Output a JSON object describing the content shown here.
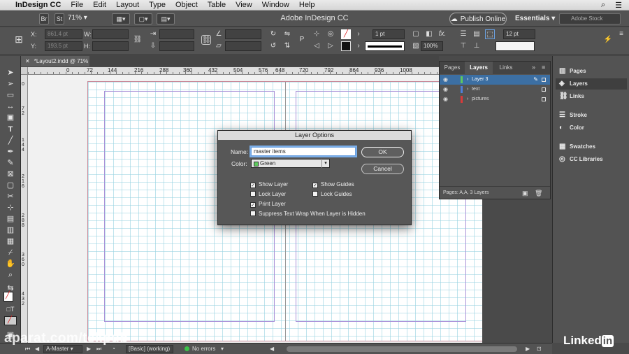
{
  "menubar": {
    "app": "InDesign CC",
    "items": [
      "File",
      "Edit",
      "Layout",
      "Type",
      "Object",
      "Table",
      "View",
      "Window",
      "Help"
    ]
  },
  "appbar": {
    "title": "Adobe InDesign CC",
    "chip_br": "Br",
    "chip_st": "St",
    "zoom": "71%",
    "publish_label": "Publish Online",
    "workspace": "Essentials",
    "stock_placeholder": "Adobe Stock"
  },
  "control": {
    "x_label": "X:",
    "x_value": "861.4 pt",
    "y_label": "Y:",
    "y_value": "193.5 pt",
    "w_label": "W:",
    "h_label": "H:",
    "stroke_weight": "1 pt",
    "opacity": "100%",
    "gutter": "12 pt"
  },
  "document": {
    "tab_title": "*Layout2.indd @ 71%",
    "ruler_h": [
      "0",
      "72",
      "144",
      "216",
      "288",
      "360",
      "432",
      "504",
      "576",
      "648",
      "720",
      "792",
      "864",
      "936",
      "1008"
    ],
    "ruler_v": [
      "0",
      "7 2",
      "1 4 4",
      "2 1 6",
      "2 8 8",
      "3 6 0",
      "4 3 2"
    ]
  },
  "layers_panel": {
    "tabs": [
      "Pages",
      "Layers",
      "Links"
    ],
    "active_tab": "Layers",
    "layers": [
      {
        "name": "Layer 3",
        "color": "#5ec95e",
        "selected": true
      },
      {
        "name": "text",
        "color": "#4f7fd9",
        "selected": false
      },
      {
        "name": "pictures",
        "color": "#d93a3a",
        "selected": false
      }
    ],
    "footer": "Pages: A,A, 3 Layers"
  },
  "dock": {
    "items": [
      "Pages",
      "Layers",
      "Links",
      "Stroke",
      "Color",
      "Swatches",
      "CC Libraries"
    ],
    "active": "Layers"
  },
  "dialog": {
    "title": "Layer Options",
    "name_label": "Name:",
    "name_value": "master items",
    "color_label": "Color:",
    "color_value": "Green",
    "ok_label": "OK",
    "cancel_label": "Cancel",
    "options": [
      {
        "label": "Show Layer",
        "checked": true
      },
      {
        "label": "Show Guides",
        "checked": true
      },
      {
        "label": "Lock Layer",
        "checked": false
      },
      {
        "label": "Lock Guides",
        "checked": false
      },
      {
        "label": "Print Layer",
        "checked": true
      },
      {
        "label": "Suppress Text Wrap When Layer is Hidden",
        "checked": false
      }
    ]
  },
  "status": {
    "page": "A-Master",
    "preflight_profile": "[Basic] (working)",
    "errors": "No errors"
  },
  "watermark": {
    "left": "aparat.com/tekpub",
    "brand": "Linked",
    "brand_in": "in"
  }
}
